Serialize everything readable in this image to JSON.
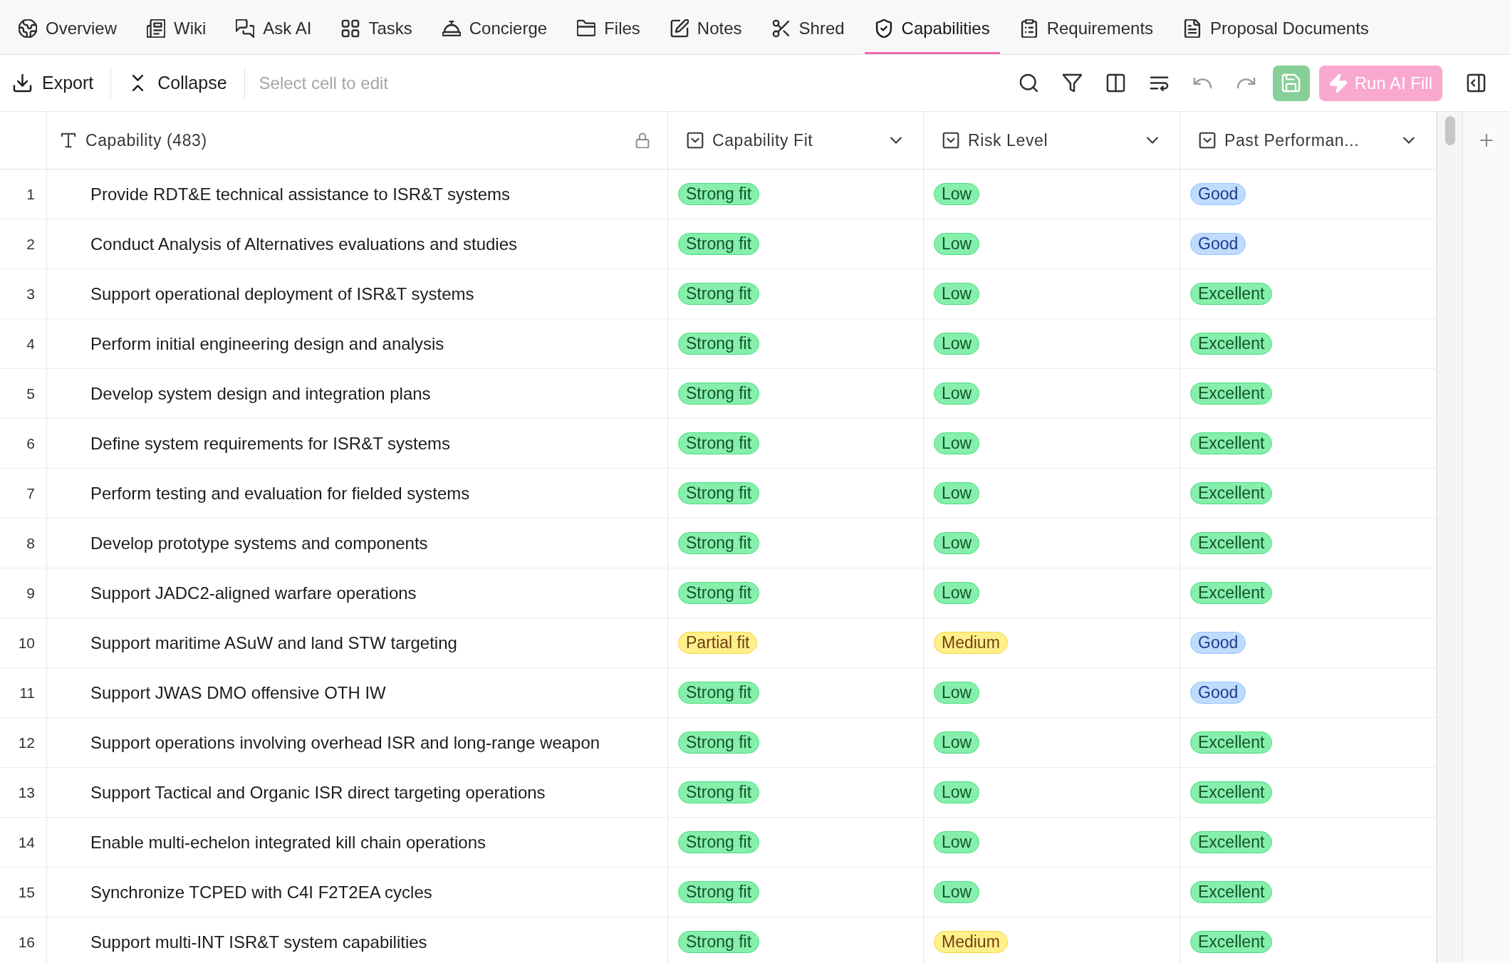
{
  "nav_tabs": [
    {
      "label": "Overview",
      "selected": false
    },
    {
      "label": "Wiki",
      "selected": false
    },
    {
      "label": "Ask AI",
      "selected": false
    },
    {
      "label": "Tasks",
      "selected": false
    },
    {
      "label": "Concierge",
      "selected": false
    },
    {
      "label": "Files",
      "selected": false
    },
    {
      "label": "Notes",
      "selected": false
    },
    {
      "label": "Shred",
      "selected": false
    },
    {
      "label": "Capabilities",
      "selected": true
    },
    {
      "label": "Requirements",
      "selected": false
    },
    {
      "label": "Proposal Documents",
      "selected": false
    }
  ],
  "toolbar": {
    "left_actions": [
      {
        "kind": "export",
        "label": "Export"
      },
      {
        "kind": "collapse",
        "label": "Collapse"
      }
    ],
    "cell_editor": {
      "placeholder": "Select cell to edit"
    },
    "right_actions": [
      {
        "kind": "search",
        "disabled": false
      },
      {
        "kind": "filter",
        "disabled": false
      },
      {
        "kind": "columns",
        "disabled": false
      },
      {
        "kind": "wrap",
        "disabled": false
      },
      {
        "kind": "undo",
        "disabled": true
      },
      {
        "kind": "redo",
        "disabled": true
      },
      {
        "kind": "save",
        "disabled": true
      },
      {
        "kind": "ai_fill",
        "label": "Run AI Fill",
        "disabled": true
      },
      {
        "kind": "panel",
        "disabled": false
      }
    ]
  },
  "table": {
    "columns": [
      {
        "kind": "text",
        "label": "Capability (483)"
      },
      {
        "kind": "select",
        "label": "Capability Fit"
      },
      {
        "kind": "select",
        "label": "Risk Level"
      },
      {
        "kind": "select",
        "label": "Past Performan..."
      }
    ],
    "rows": [
      {
        "number": "1",
        "capability": "Provide RDT&E technical assistance to ISR&T systems",
        "tags": [
          {
            "text": "Strong fit",
            "color": "#86efac"
          },
          {
            "text": "Low",
            "color": "#86efac"
          },
          {
            "text": "Good",
            "color": "#bfdbfe"
          }
        ]
      },
      {
        "number": "2",
        "capability": "Conduct Analysis of Alternatives evaluations and studies",
        "tags": [
          {
            "text": "Strong fit",
            "color": "#86efac"
          },
          {
            "text": "Low",
            "color": "#86efac"
          },
          {
            "text": "Good",
            "color": "#bfdbfe"
          }
        ]
      },
      {
        "number": "3",
        "capability": "Support operational deployment of ISR&T systems",
        "tags": [
          {
            "text": "Strong fit",
            "color": "#86efac"
          },
          {
            "text": "Low",
            "color": "#86efac"
          },
          {
            "text": "Excellent",
            "color": "#86efac"
          }
        ]
      },
      {
        "number": "4",
        "capability": "Perform initial engineering design and analysis",
        "tags": [
          {
            "text": "Strong fit",
            "color": "#86efac"
          },
          {
            "text": "Low",
            "color": "#86efac"
          },
          {
            "text": "Excellent",
            "color": "#86efac"
          }
        ]
      },
      {
        "number": "5",
        "capability": "Develop system design and integration plans",
        "tags": [
          {
            "text": "Strong fit",
            "color": "#86efac"
          },
          {
            "text": "Low",
            "color": "#86efac"
          },
          {
            "text": "Excellent",
            "color": "#86efac"
          }
        ]
      },
      {
        "number": "6",
        "capability": "Define system requirements for ISR&T systems",
        "tags": [
          {
            "text": "Strong fit",
            "color": "#86efac"
          },
          {
            "text": "Low",
            "color": "#86efac"
          },
          {
            "text": "Excellent",
            "color": "#86efac"
          }
        ]
      },
      {
        "number": "7",
        "capability": "Perform testing and evaluation for fielded systems",
        "tags": [
          {
            "text": "Strong fit",
            "color": "#86efac"
          },
          {
            "text": "Low",
            "color": "#86efac"
          },
          {
            "text": "Excellent",
            "color": "#86efac"
          }
        ]
      },
      {
        "number": "8",
        "capability": "Develop prototype systems and components",
        "tags": [
          {
            "text": "Strong fit",
            "color": "#86efac"
          },
          {
            "text": "Low",
            "color": "#86efac"
          },
          {
            "text": "Excellent",
            "color": "#86efac"
          }
        ]
      },
      {
        "number": "9",
        "capability": "Support JADC2-aligned warfare operations",
        "tags": [
          {
            "text": "Strong fit",
            "color": "#86efac"
          },
          {
            "text": "Low",
            "color": "#86efac"
          },
          {
            "text": "Excellent",
            "color": "#86efac"
          }
        ]
      },
      {
        "number": "10",
        "capability": "Support maritime ASuW and land STW targeting",
        "tags": [
          {
            "text": "Partial fit",
            "color": "#fef08a"
          },
          {
            "text": "Medium",
            "color": "#fef08a"
          },
          {
            "text": "Good",
            "color": "#bfdbfe"
          }
        ]
      },
      {
        "number": "11",
        "capability": "Support JWAS DMO offensive OTH IW",
        "tags": [
          {
            "text": "Strong fit",
            "color": "#86efac"
          },
          {
            "text": "Low",
            "color": "#86efac"
          },
          {
            "text": "Good",
            "color": "#bfdbfe"
          }
        ]
      },
      {
        "number": "12",
        "capability": "Support operations involving overhead ISR and long-range weapon",
        "tags": [
          {
            "text": "Strong fit",
            "color": "#86efac"
          },
          {
            "text": "Low",
            "color": "#86efac"
          },
          {
            "text": "Excellent",
            "color": "#86efac"
          }
        ]
      },
      {
        "number": "13",
        "capability": "Support Tactical and Organic ISR direct targeting operations",
        "tags": [
          {
            "text": "Strong fit",
            "color": "#86efac"
          },
          {
            "text": "Low",
            "color": "#86efac"
          },
          {
            "text": "Excellent",
            "color": "#86efac"
          }
        ]
      },
      {
        "number": "14",
        "capability": "Enable multi-echelon integrated kill chain operations",
        "tags": [
          {
            "text": "Strong fit",
            "color": "#86efac"
          },
          {
            "text": "Low",
            "color": "#86efac"
          },
          {
            "text": "Excellent",
            "color": "#86efac"
          }
        ]
      },
      {
        "number": "15",
        "capability": "Synchronize TCPED with C4I F2T2EA cycles",
        "tags": [
          {
            "text": "Strong fit",
            "color": "#86efac"
          },
          {
            "text": "Low",
            "color": "#86efac"
          },
          {
            "text": "Excellent",
            "color": "#86efac"
          }
        ]
      },
      {
        "number": "16",
        "capability": "Support multi-INT ISR&T system capabilities",
        "tags": [
          {
            "text": "Strong fit",
            "color": "#86efac"
          },
          {
            "text": "Medium",
            "color": "#fef08a"
          },
          {
            "text": "Excellent",
            "color": "#86efac"
          }
        ]
      }
    ]
  }
}
